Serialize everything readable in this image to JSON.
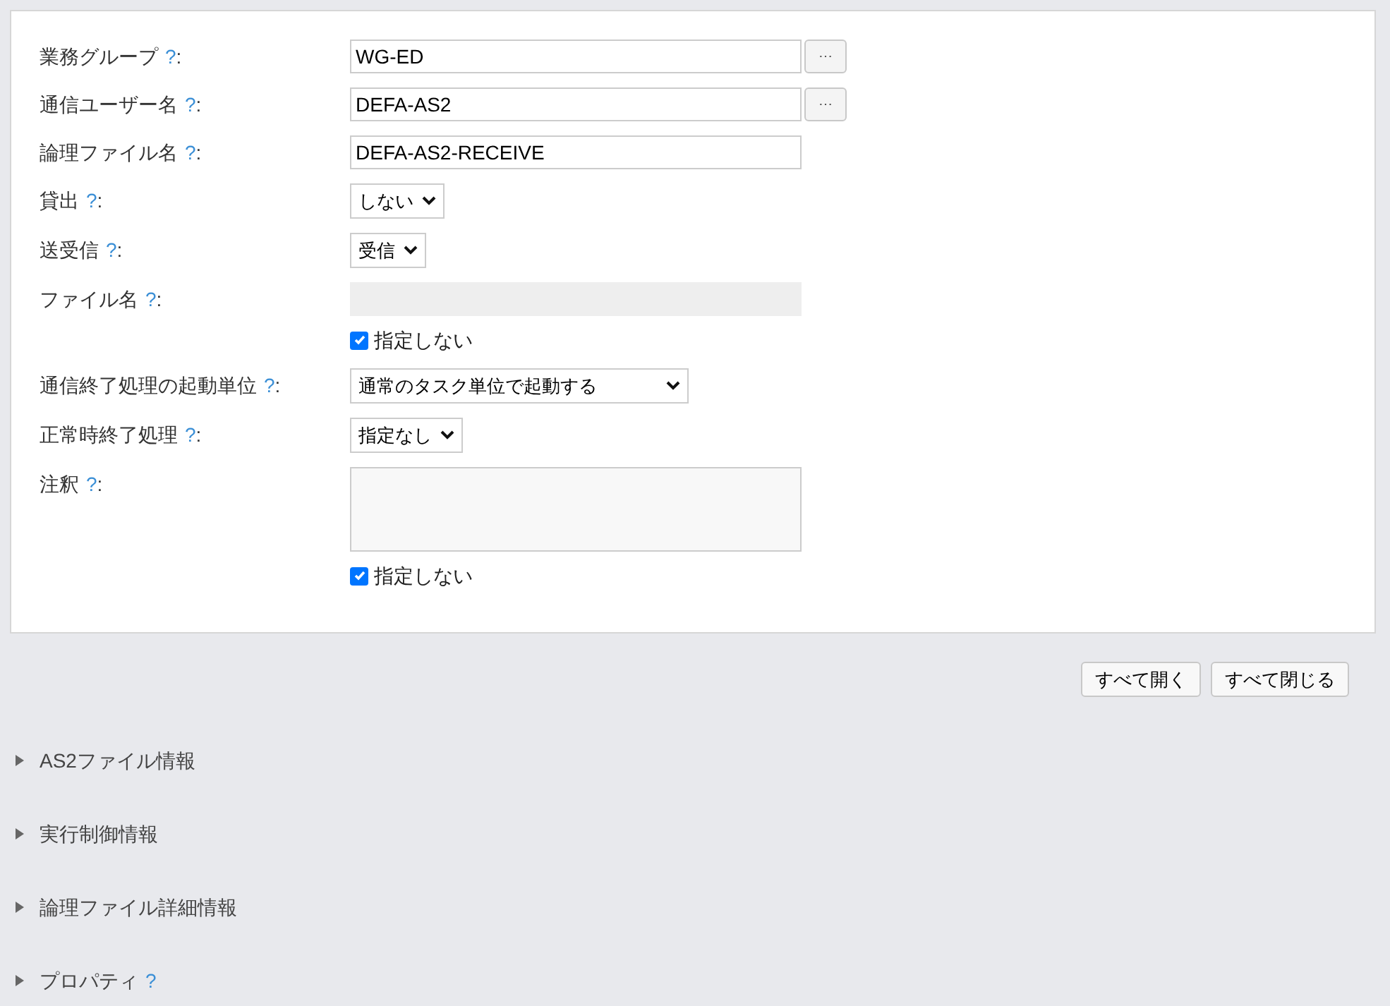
{
  "form": {
    "fields": [
      {
        "kind": "text",
        "label": "業務グループ",
        "help": "?",
        "colon": ":",
        "value": "WG-ED",
        "browse": "⋯"
      },
      {
        "kind": "text",
        "label": "通信ユーザー名",
        "help": "?",
        "colon": ":",
        "value": "DEFA-AS2",
        "browse": "⋯"
      },
      {
        "kind": "text",
        "label": "論理ファイル名",
        "help": "?",
        "colon": ":",
        "value": "DEFA-AS2-RECEIVE"
      },
      {
        "kind": "select",
        "label": "貸出",
        "help": "?",
        "colon": ":",
        "value": "しない"
      },
      {
        "kind": "select",
        "label": "送受信",
        "help": "?",
        "colon": ":",
        "value": "受信"
      },
      {
        "kind": "text",
        "label": "ファイル名",
        "help": "?",
        "colon": ":",
        "disabled": true,
        "checkbox": {
          "label": "指定しない",
          "checked": true
        }
      },
      {
        "kind": "select",
        "label": "通信終了処理の起動単位",
        "help": "?",
        "colon": ":",
        "value": "通常のタスク単位で起動する",
        "wide": true
      },
      {
        "kind": "select",
        "label": "正常時終了処理",
        "help": "?",
        "colon": ":",
        "value": "指定なし"
      },
      {
        "kind": "textarea",
        "label": "注釈",
        "help": "?",
        "colon": ":",
        "disabled": true,
        "checkbox": {
          "label": "指定しない",
          "checked": true
        }
      }
    ]
  },
  "buttons": [
    "すべて開く",
    "すべて閉じる"
  ],
  "sections": [
    {
      "title": "AS2ファイル情報",
      "expanded": false
    },
    {
      "title": "実行制御情報",
      "expanded": false
    },
    {
      "title": "論理ファイル詳細情報",
      "expanded": false
    },
    {
      "title": "プロパティ",
      "help": "?",
      "expanded": false
    }
  ]
}
